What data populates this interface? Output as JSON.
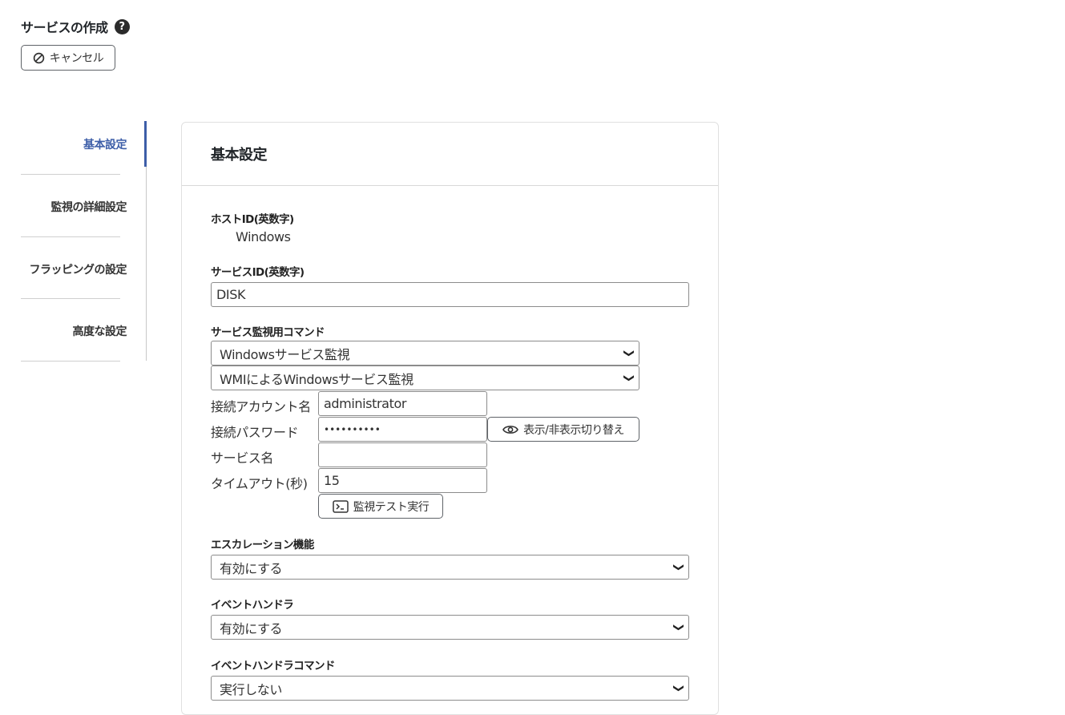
{
  "header": {
    "title": "サービスの作成",
    "help_icon": "question-circle-icon"
  },
  "cancel_button": {
    "label": "キャンセル",
    "icon": "ban-icon"
  },
  "sidenav": {
    "items": [
      {
        "label": "基本設定",
        "active": true
      },
      {
        "label": "監視の詳細設定",
        "active": false
      },
      {
        "label": "フラッピングの設定",
        "active": false
      },
      {
        "label": "高度な設定",
        "active": false
      }
    ],
    "active_color": "#3d5ea8"
  },
  "card": {
    "title": "基本設定",
    "host_id": {
      "label": "ホストID(英数字)",
      "value": "Windows"
    },
    "service_id": {
      "label": "サービスID(英数字)",
      "value": "DISK"
    },
    "command": {
      "label": "サービス監視用コマンド",
      "category_selected": "Windowsサービス監視",
      "command_selected": "WMIによるWindowsサービス監視",
      "params": {
        "account": {
          "label": "接続アカウント名",
          "value": "administrator"
        },
        "password": {
          "label": "接続パスワード",
          "value": "••••••••••"
        },
        "service_name": {
          "label": "サービス名",
          "value": ""
        },
        "timeout": {
          "label": "タイムアウト(秒)",
          "value": "15"
        }
      },
      "toggle_button": {
        "label": "表示/非表示切り替え",
        "icon": "eye-icon"
      },
      "test_button": {
        "label": "監視テスト実行",
        "icon": "terminal-icon"
      }
    },
    "escalation": {
      "label": "エスカレーション機能",
      "selected": "有効にする"
    },
    "event_handler": {
      "label": "イベントハンドラ",
      "selected": "有効にする"
    },
    "event_handler_command": {
      "label": "イベントハンドラコマンド",
      "selected": "実行しない"
    }
  }
}
